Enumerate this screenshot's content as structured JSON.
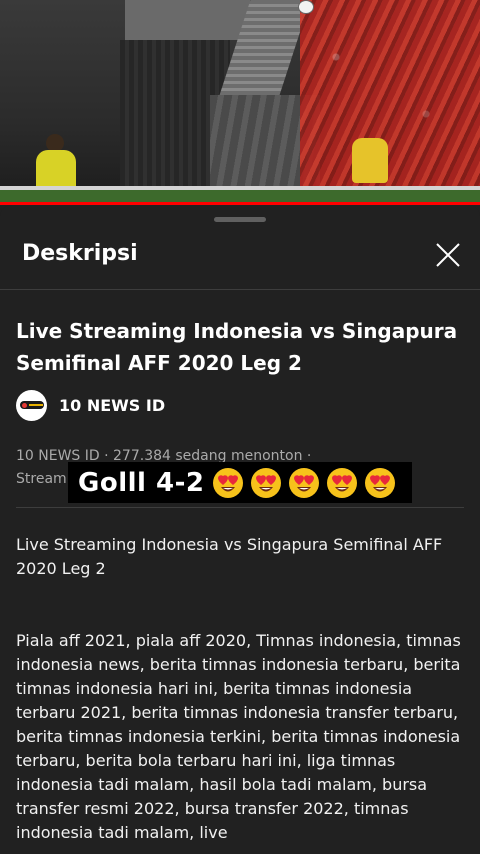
{
  "video": {
    "progress_percent": 100,
    "accent_color": "#ff0000"
  },
  "sheet": {
    "title": "Deskripsi",
    "close_icon": "close-icon"
  },
  "video_info": {
    "title": "Live Streaming Indonesia  vs Singapura Semifinal AFF 2020 Leg 2",
    "channel_name": "10 NEWS ID",
    "meta_line1": "10 NEWS ID · 277.384 sedang menonton ·",
    "meta_line2": "Stream"
  },
  "description": {
    "paragraph1": "Live Streaming Indonesia  vs Singapura Semifinal AFF 2020 Leg 2",
    "paragraph2": "Piala aff 2021, piala aff 2020, Timnas indonesia, timnas indonesia news, berita timnas indonesia terbaru, berita timnas indonesia hari ini, berita timnas indonesia terbaru 2021, berita timnas indonesia transfer terbaru, berita timnas indonesia terkini, berita timnas indonesia terbaru, berita bola terbaru hari ini, liga timnas indonesia tadi malam, hasil bola tadi malam, bursa transfer resmi 2022,  bursa transfer 2022, timnas indonesia tadi malam, live"
  },
  "overlay": {
    "caption": "Golll 4-2",
    "emoji_icon": "heart-eyes-emoji-icon",
    "emoji_count": 5
  }
}
